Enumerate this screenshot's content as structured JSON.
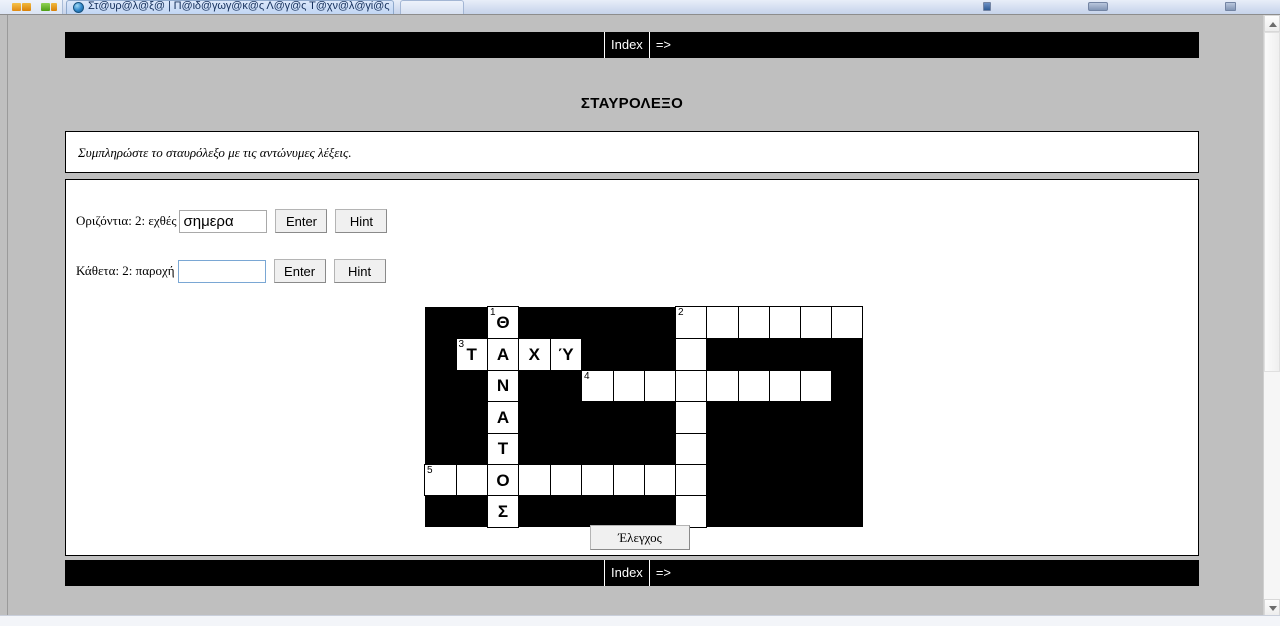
{
  "browser": {
    "tab_title": "Στ@υρ@λ@ξ@ | Π@ιδ@γωγ@κ@ς Λ@γ@ς Τ@χν@λ@γί@ς",
    "favicon_name": "browser-globe-icon"
  },
  "nav": {
    "index_label": "Index",
    "next_label": "=>"
  },
  "page": {
    "title": "ΣΤΑΥΡΟΛΕΞΟ",
    "instructions": "Συμπληρώστε το σταυρόλεξο με τις αντώνυμες λέξεις."
  },
  "clues": [
    {
      "label": "Οριζόντια: 2: εχθές",
      "value": "σημερα",
      "focused": false,
      "enter_label": "Enter",
      "hint_label": "Hint"
    },
    {
      "label": "Κάθετα: 2: παροχή",
      "value": "",
      "focused": true,
      "enter_label": "Enter",
      "hint_label": "Hint"
    }
  ],
  "check_button_label": "Έλεγχος",
  "crossword": {
    "columns": 14,
    "rows": 7,
    "cell_size": 31,
    "grid": [
      [
        {
          "t": "blk"
        },
        {
          "t": "blk"
        },
        {
          "t": "cell",
          "num": "1",
          "letter": "Θ"
        },
        {
          "t": "blk"
        },
        {
          "t": "blk"
        },
        {
          "t": "blk"
        },
        {
          "t": "blk"
        },
        {
          "t": "blk"
        },
        {
          "t": "cell",
          "num": "2",
          "letter": ""
        },
        {
          "t": "cell",
          "num": "",
          "letter": ""
        },
        {
          "t": "cell",
          "num": "",
          "letter": ""
        },
        {
          "t": "cell",
          "num": "",
          "letter": ""
        },
        {
          "t": "cell",
          "num": "",
          "letter": ""
        },
        {
          "t": "cell",
          "num": "",
          "letter": ""
        }
      ],
      [
        {
          "t": "blk"
        },
        {
          "t": "cell",
          "num": "3",
          "letter": "Τ"
        },
        {
          "t": "cell",
          "num": "",
          "letter": "Α"
        },
        {
          "t": "cell",
          "num": "",
          "letter": "Χ"
        },
        {
          "t": "cell",
          "num": "",
          "letter": "Ύ"
        },
        {
          "t": "blk"
        },
        {
          "t": "blk"
        },
        {
          "t": "blk"
        },
        {
          "t": "cell",
          "num": "",
          "letter": ""
        },
        {
          "t": "blk"
        },
        {
          "t": "blk"
        },
        {
          "t": "blk"
        },
        {
          "t": "blk"
        },
        {
          "t": "blk"
        }
      ],
      [
        {
          "t": "blk"
        },
        {
          "t": "blk"
        },
        {
          "t": "cell",
          "num": "",
          "letter": "Ν"
        },
        {
          "t": "blk"
        },
        {
          "t": "blk"
        },
        {
          "t": "cell",
          "num": "4",
          "letter": ""
        },
        {
          "t": "cell",
          "num": "",
          "letter": ""
        },
        {
          "t": "cell",
          "num": "",
          "letter": ""
        },
        {
          "t": "cell",
          "num": "",
          "letter": ""
        },
        {
          "t": "cell",
          "num": "",
          "letter": ""
        },
        {
          "t": "cell",
          "num": "",
          "letter": ""
        },
        {
          "t": "cell",
          "num": "",
          "letter": ""
        },
        {
          "t": "cell",
          "num": "",
          "letter": ""
        },
        {
          "t": "blk"
        }
      ],
      [
        {
          "t": "blk"
        },
        {
          "t": "blk"
        },
        {
          "t": "cell",
          "num": "",
          "letter": "Α"
        },
        {
          "t": "blk"
        },
        {
          "t": "blk"
        },
        {
          "t": "blk"
        },
        {
          "t": "blk"
        },
        {
          "t": "blk"
        },
        {
          "t": "cell",
          "num": "",
          "letter": ""
        },
        {
          "t": "blk"
        },
        {
          "t": "blk"
        },
        {
          "t": "blk"
        },
        {
          "t": "blk"
        },
        {
          "t": "blk"
        }
      ],
      [
        {
          "t": "blk"
        },
        {
          "t": "blk"
        },
        {
          "t": "cell",
          "num": "",
          "letter": "Τ"
        },
        {
          "t": "blk"
        },
        {
          "t": "blk"
        },
        {
          "t": "blk"
        },
        {
          "t": "blk"
        },
        {
          "t": "blk"
        },
        {
          "t": "cell",
          "num": "",
          "letter": ""
        },
        {
          "t": "blk"
        },
        {
          "t": "blk"
        },
        {
          "t": "blk"
        },
        {
          "t": "blk"
        },
        {
          "t": "blk"
        }
      ],
      [
        {
          "t": "cell",
          "num": "5",
          "letter": ""
        },
        {
          "t": "cell",
          "num": "",
          "letter": ""
        },
        {
          "t": "cell",
          "num": "",
          "letter": "Ο"
        },
        {
          "t": "cell",
          "num": "",
          "letter": ""
        },
        {
          "t": "cell",
          "num": "",
          "letter": ""
        },
        {
          "t": "cell",
          "num": "",
          "letter": ""
        },
        {
          "t": "cell",
          "num": "",
          "letter": ""
        },
        {
          "t": "cell",
          "num": "",
          "letter": ""
        },
        {
          "t": "cell",
          "num": "",
          "letter": ""
        },
        {
          "t": "blk"
        },
        {
          "t": "blk"
        },
        {
          "t": "blk"
        },
        {
          "t": "blk"
        },
        {
          "t": "blk"
        }
      ],
      [
        {
          "t": "blk"
        },
        {
          "t": "blk"
        },
        {
          "t": "cell",
          "num": "",
          "letter": "Σ"
        },
        {
          "t": "blk"
        },
        {
          "t": "blk"
        },
        {
          "t": "blk"
        },
        {
          "t": "blk"
        },
        {
          "t": "blk"
        },
        {
          "t": "cell",
          "num": "",
          "letter": ""
        },
        {
          "t": "blk"
        },
        {
          "t": "blk"
        },
        {
          "t": "blk"
        },
        {
          "t": "blk"
        },
        {
          "t": "blk"
        }
      ]
    ]
  }
}
